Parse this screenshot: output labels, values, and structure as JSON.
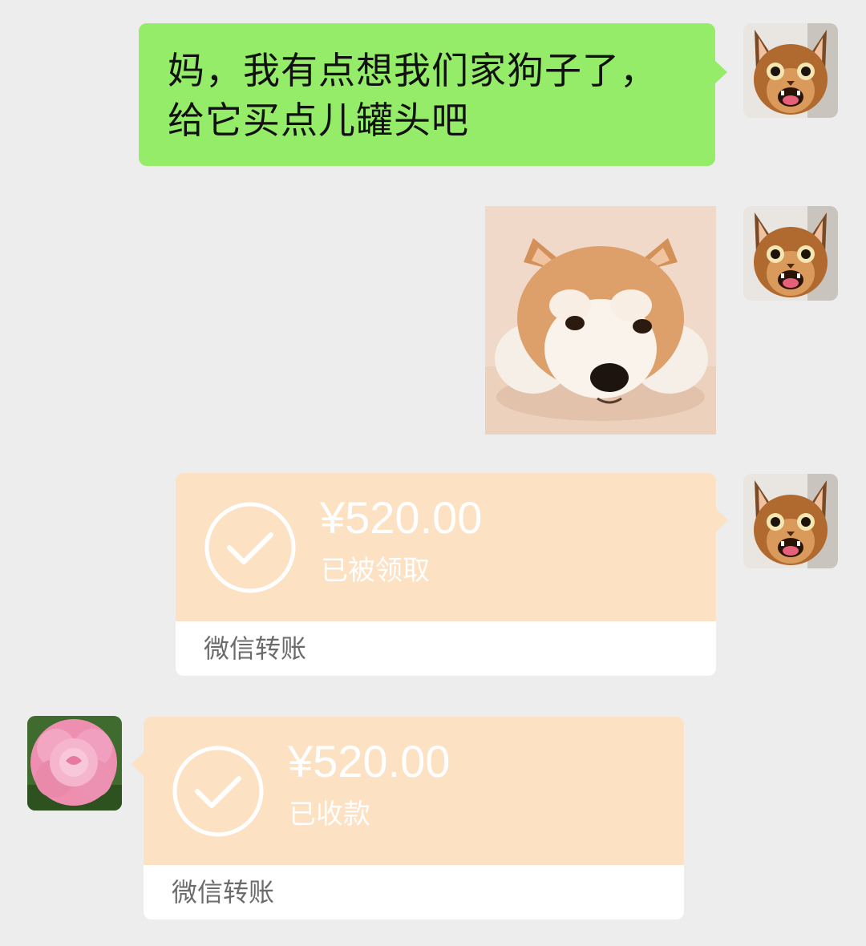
{
  "conversation": {
    "messages": [
      {
        "sender": "me",
        "type": "text",
        "lines": [
          "妈，我有点想我们家狗子了，",
          "给它买点儿罐头吧"
        ]
      },
      {
        "sender": "me",
        "type": "image",
        "image_subject": "shiba-inu-dog"
      },
      {
        "sender": "me",
        "type": "transfer",
        "amount": "¥520.00",
        "status": "已被领取",
        "label": "微信转账"
      },
      {
        "sender": "mom",
        "type": "transfer",
        "amount": "¥520.00",
        "status": "已收款",
        "label": "微信转账"
      }
    ]
  },
  "icons": {
    "my_avatar": "cat-avatar-icon",
    "mom_avatar": "pink-flower-avatar-icon",
    "transfer_status": "check-circle-icon"
  },
  "colors": {
    "background": "#ededed",
    "my_bubble": "#95ec69",
    "transfer_card": "#fde1c3",
    "transfer_footer": "#ffffff"
  }
}
